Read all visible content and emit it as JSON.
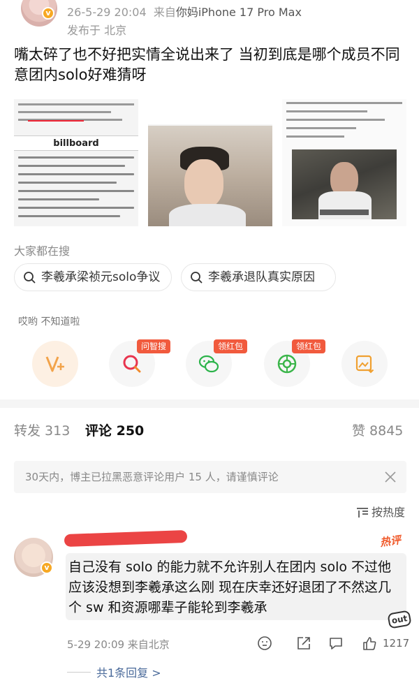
{
  "post": {
    "timestamp": "26-5-29 20:04",
    "source_prefix": "来自",
    "source_device": "你妈iPhone 17 Pro Max",
    "location": "发布于 北京",
    "text": "嘴太碎了也不好把实情全说出来了 当初到底是哪个成员不同意团内solo好难猜呀",
    "thumbnails": {
      "t1_brand": "billboard"
    }
  },
  "search": {
    "title": "大家都在搜",
    "chips": [
      "李羲承梁祯元solo争议",
      "李羲承退队真实原因"
    ]
  },
  "quick_actions": {
    "label": "哎哟 不知道啦",
    "tags": [
      "问智搜",
      "领红包",
      "领红包"
    ],
    "icons": [
      "v-plus-icon",
      "smart-search-icon",
      "wechat-icon",
      "moments-icon",
      "save-image-icon"
    ]
  },
  "tabs": {
    "repost": "转发 313",
    "comment": "评论 250",
    "like": "赞 8845"
  },
  "notice": {
    "text": "30天内，博主已拉黑恶意评论用户 15 人，请谨慎评论"
  },
  "sort": {
    "label": "按热度"
  },
  "comment": {
    "hot_label": "热评",
    "text": "自己没有 solo 的能力就不允许别人在团内 solo 不过他应该没想到李羲承这么刚 现在庆幸还好退团了不然这几个 sw 和资源哪辈子能轮到李羲承",
    "stamp": "out",
    "meta": "5-29 20:09  来自北京",
    "likes": "1217",
    "replies_link": "共1条回复 >"
  },
  "colors": {
    "accent_orange": "#f15a3d",
    "hot_orange": "#f05a2b",
    "link_blue": "#4a6a9a",
    "redact_red": "#e93434"
  }
}
